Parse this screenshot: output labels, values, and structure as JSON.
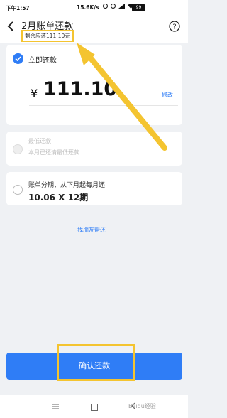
{
  "status_bar": {
    "time": "下午1:57",
    "network_speed": "15.6K/s",
    "battery": "99"
  },
  "header": {
    "title": "2月账单还款",
    "subtitle": "剩余应还111.10元"
  },
  "options": {
    "immediate": {
      "label": "立即还款",
      "currency": "¥",
      "amount": "111.10",
      "edit": "修改"
    },
    "minimum": {
      "label": "最低还款",
      "desc": "本月已还清最低还款"
    },
    "installment": {
      "label": "账单分期，从下月起每月还",
      "value": "10.06 X 12期"
    }
  },
  "friend_link": "找朋友帮还",
  "confirm_button": "确认还款",
  "watermark": "Baidu经验",
  "colors": {
    "accent": "#2f7df6",
    "highlight": "#f4c430",
    "background": "#eff1f4"
  },
  "icons": {
    "back": "back-icon",
    "help": "help-icon",
    "check": "check-icon",
    "nav_menu": "menu-icon",
    "nav_home": "home-icon",
    "nav_back": "back-nav-icon"
  }
}
